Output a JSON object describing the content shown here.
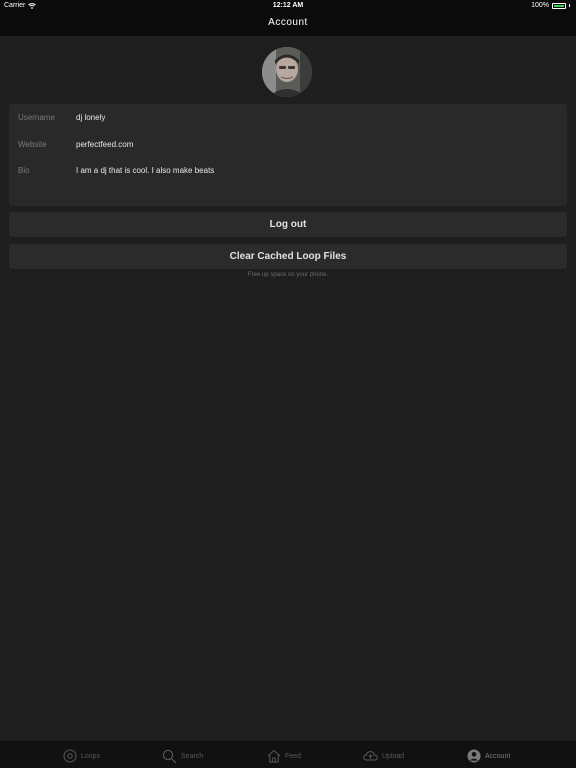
{
  "status_bar": {
    "carrier": "Carrier",
    "time": "12:12 AM",
    "battery": "100%",
    "battery_color": "#3fd14a"
  },
  "nav": {
    "title": "Account"
  },
  "profile": {
    "avatar_icon": "user-photo",
    "fields": [
      {
        "label": "Username",
        "value": "dj lonely"
      },
      {
        "label": "Website",
        "value": "perfectfeed.com"
      },
      {
        "label": "Bio",
        "value": "I am a dj that is cool. I also make beats"
      }
    ]
  },
  "actions": {
    "logout_label": "Log out",
    "clear_cache_label": "Clear Cached Loop Files",
    "clear_cache_hint": "Free up space on your phone."
  },
  "tabbar": {
    "items": [
      {
        "label": "Loops",
        "icon": "disc-icon"
      },
      {
        "label": "Search",
        "icon": "search-icon"
      },
      {
        "label": "Feed",
        "icon": "home-icon"
      },
      {
        "label": "Upload",
        "icon": "cloud-upload-icon"
      },
      {
        "label": "Account",
        "icon": "person-icon",
        "active": true
      }
    ]
  }
}
